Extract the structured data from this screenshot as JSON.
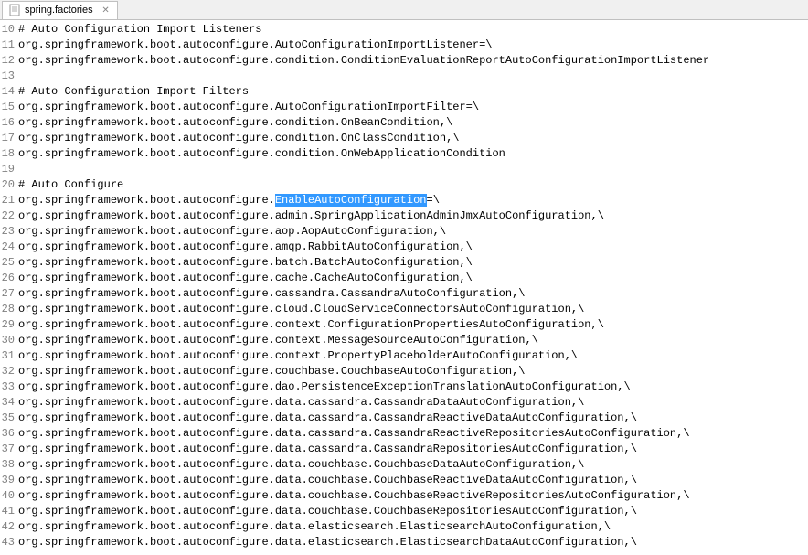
{
  "tab": {
    "title": "spring.factories",
    "close_symbol": "✕"
  },
  "lines": [
    {
      "num": 10,
      "segments": [
        {
          "text": "# Auto Configuration Import Listeners"
        }
      ]
    },
    {
      "num": 11,
      "segments": [
        {
          "text": "org.springframework.boot.autoconfigure.AutoConfigurationImportListener=\\"
        }
      ]
    },
    {
      "num": 12,
      "segments": [
        {
          "text": "org.springframework.boot.autoconfigure.condition.ConditionEvaluationReportAutoConfigurationImportListener"
        }
      ]
    },
    {
      "num": 13,
      "segments": [
        {
          "text": ""
        }
      ]
    },
    {
      "num": 14,
      "segments": [
        {
          "text": "# Auto Configuration Import Filters"
        }
      ]
    },
    {
      "num": 15,
      "segments": [
        {
          "text": "org.springframework.boot.autoconfigure.AutoConfigurationImportFilter=\\"
        }
      ]
    },
    {
      "num": 16,
      "segments": [
        {
          "text": "org.springframework.boot.autoconfigure.condition.OnBeanCondition,\\"
        }
      ]
    },
    {
      "num": 17,
      "segments": [
        {
          "text": "org.springframework.boot.autoconfigure.condition.OnClassCondition,\\"
        }
      ]
    },
    {
      "num": 18,
      "segments": [
        {
          "text": "org.springframework.boot.autoconfigure.condition.OnWebApplicationCondition"
        }
      ]
    },
    {
      "num": 19,
      "segments": [
        {
          "text": ""
        }
      ]
    },
    {
      "num": 20,
      "segments": [
        {
          "text": "# Auto Configure"
        }
      ]
    },
    {
      "num": 21,
      "segments": [
        {
          "text": "org.springframework.boot.autoconfigure."
        },
        {
          "text": "EnableAutoConfiguration",
          "highlighted": true
        },
        {
          "text": "=\\"
        }
      ]
    },
    {
      "num": 22,
      "segments": [
        {
          "text": "org.springframework.boot.autoconfigure.admin.SpringApplicationAdminJmxAutoConfiguration,\\"
        }
      ]
    },
    {
      "num": 23,
      "segments": [
        {
          "text": "org.springframework.boot.autoconfigure.aop.AopAutoConfiguration,\\"
        }
      ]
    },
    {
      "num": 24,
      "segments": [
        {
          "text": "org.springframework.boot.autoconfigure.amqp.RabbitAutoConfiguration,\\"
        }
      ]
    },
    {
      "num": 25,
      "segments": [
        {
          "text": "org.springframework.boot.autoconfigure.batch.BatchAutoConfiguration,\\"
        }
      ]
    },
    {
      "num": 26,
      "segments": [
        {
          "text": "org.springframework.boot.autoconfigure.cache.CacheAutoConfiguration,\\"
        }
      ]
    },
    {
      "num": 27,
      "segments": [
        {
          "text": "org.springframework.boot.autoconfigure.cassandra.CassandraAutoConfiguration,\\"
        }
      ]
    },
    {
      "num": 28,
      "segments": [
        {
          "text": "org.springframework.boot.autoconfigure.cloud.CloudServiceConnectorsAutoConfiguration,\\"
        }
      ]
    },
    {
      "num": 29,
      "segments": [
        {
          "text": "org.springframework.boot.autoconfigure.context.ConfigurationPropertiesAutoConfiguration,\\"
        }
      ]
    },
    {
      "num": 30,
      "segments": [
        {
          "text": "org.springframework.boot.autoconfigure.context.MessageSourceAutoConfiguration,\\"
        }
      ]
    },
    {
      "num": 31,
      "segments": [
        {
          "text": "org.springframework.boot.autoconfigure.context.PropertyPlaceholderAutoConfiguration,\\"
        }
      ]
    },
    {
      "num": 32,
      "segments": [
        {
          "text": "org.springframework.boot.autoconfigure.couchbase.CouchbaseAutoConfiguration,\\"
        }
      ]
    },
    {
      "num": 33,
      "segments": [
        {
          "text": "org.springframework.boot.autoconfigure.dao.PersistenceExceptionTranslationAutoConfiguration,\\"
        }
      ]
    },
    {
      "num": 34,
      "segments": [
        {
          "text": "org.springframework.boot.autoconfigure.data.cassandra.CassandraDataAutoConfiguration,\\"
        }
      ]
    },
    {
      "num": 35,
      "segments": [
        {
          "text": "org.springframework.boot.autoconfigure.data.cassandra.CassandraReactiveDataAutoConfiguration,\\"
        }
      ]
    },
    {
      "num": 36,
      "segments": [
        {
          "text": "org.springframework.boot.autoconfigure.data.cassandra.CassandraReactiveRepositoriesAutoConfiguration,\\"
        }
      ]
    },
    {
      "num": 37,
      "segments": [
        {
          "text": "org.springframework.boot.autoconfigure.data.cassandra.CassandraRepositoriesAutoConfiguration,\\"
        }
      ]
    },
    {
      "num": 38,
      "segments": [
        {
          "text": "org.springframework.boot.autoconfigure.data.couchbase.CouchbaseDataAutoConfiguration,\\"
        }
      ]
    },
    {
      "num": 39,
      "segments": [
        {
          "text": "org.springframework.boot.autoconfigure.data.couchbase.CouchbaseReactiveDataAutoConfiguration,\\"
        }
      ]
    },
    {
      "num": 40,
      "segments": [
        {
          "text": "org.springframework.boot.autoconfigure.data.couchbase.CouchbaseReactiveRepositoriesAutoConfiguration,\\"
        }
      ]
    },
    {
      "num": 41,
      "segments": [
        {
          "text": "org.springframework.boot.autoconfigure.data.couchbase.CouchbaseRepositoriesAutoConfiguration,\\"
        }
      ]
    },
    {
      "num": 42,
      "segments": [
        {
          "text": "org.springframework.boot.autoconfigure.data.elasticsearch.ElasticsearchAutoConfiguration,\\"
        }
      ]
    },
    {
      "num": 43,
      "segments": [
        {
          "text": "org.springframework.boot.autoconfigure.data.elasticsearch.ElasticsearchDataAutoConfiguration,\\"
        }
      ]
    }
  ]
}
